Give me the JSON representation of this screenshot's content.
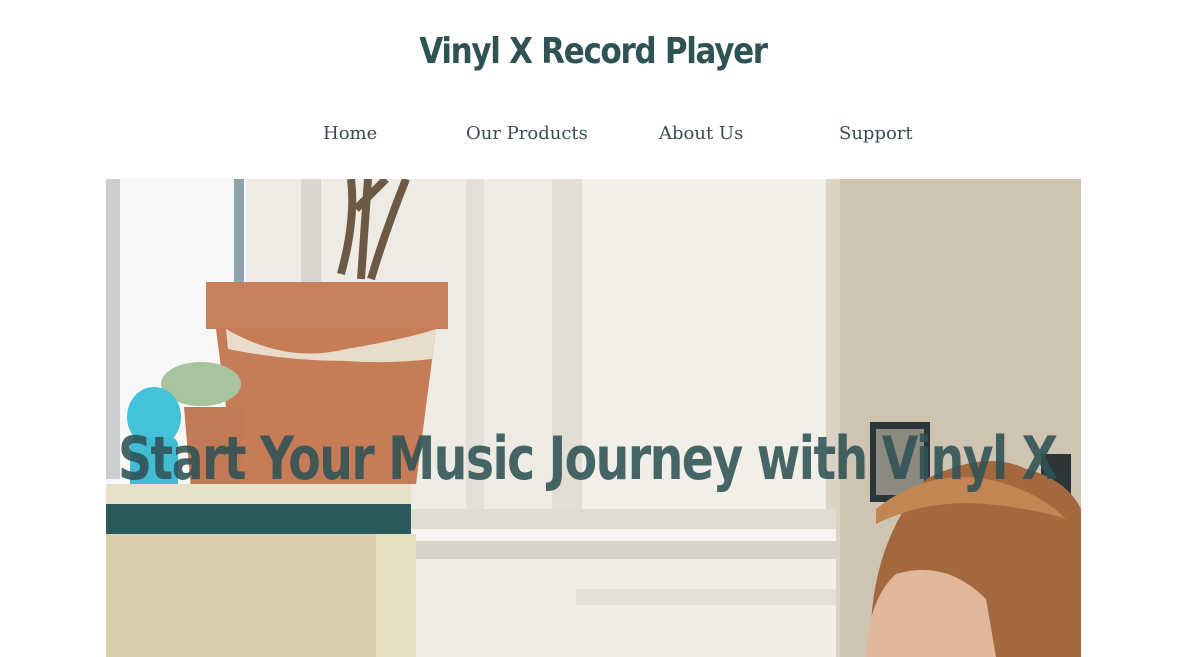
{
  "header": {
    "title": "Vinyl X Record Player"
  },
  "nav": {
    "items": [
      {
        "label": "Home"
      },
      {
        "label": "Our Products"
      },
      {
        "label": "About Us"
      },
      {
        "label": "Support"
      }
    ]
  },
  "hero": {
    "headline": "Start Your Music Journey with Vinyl X"
  },
  "colors": {
    "title": "#2f5255",
    "nav_text": "#3b4d52",
    "background": "#ffffff"
  }
}
